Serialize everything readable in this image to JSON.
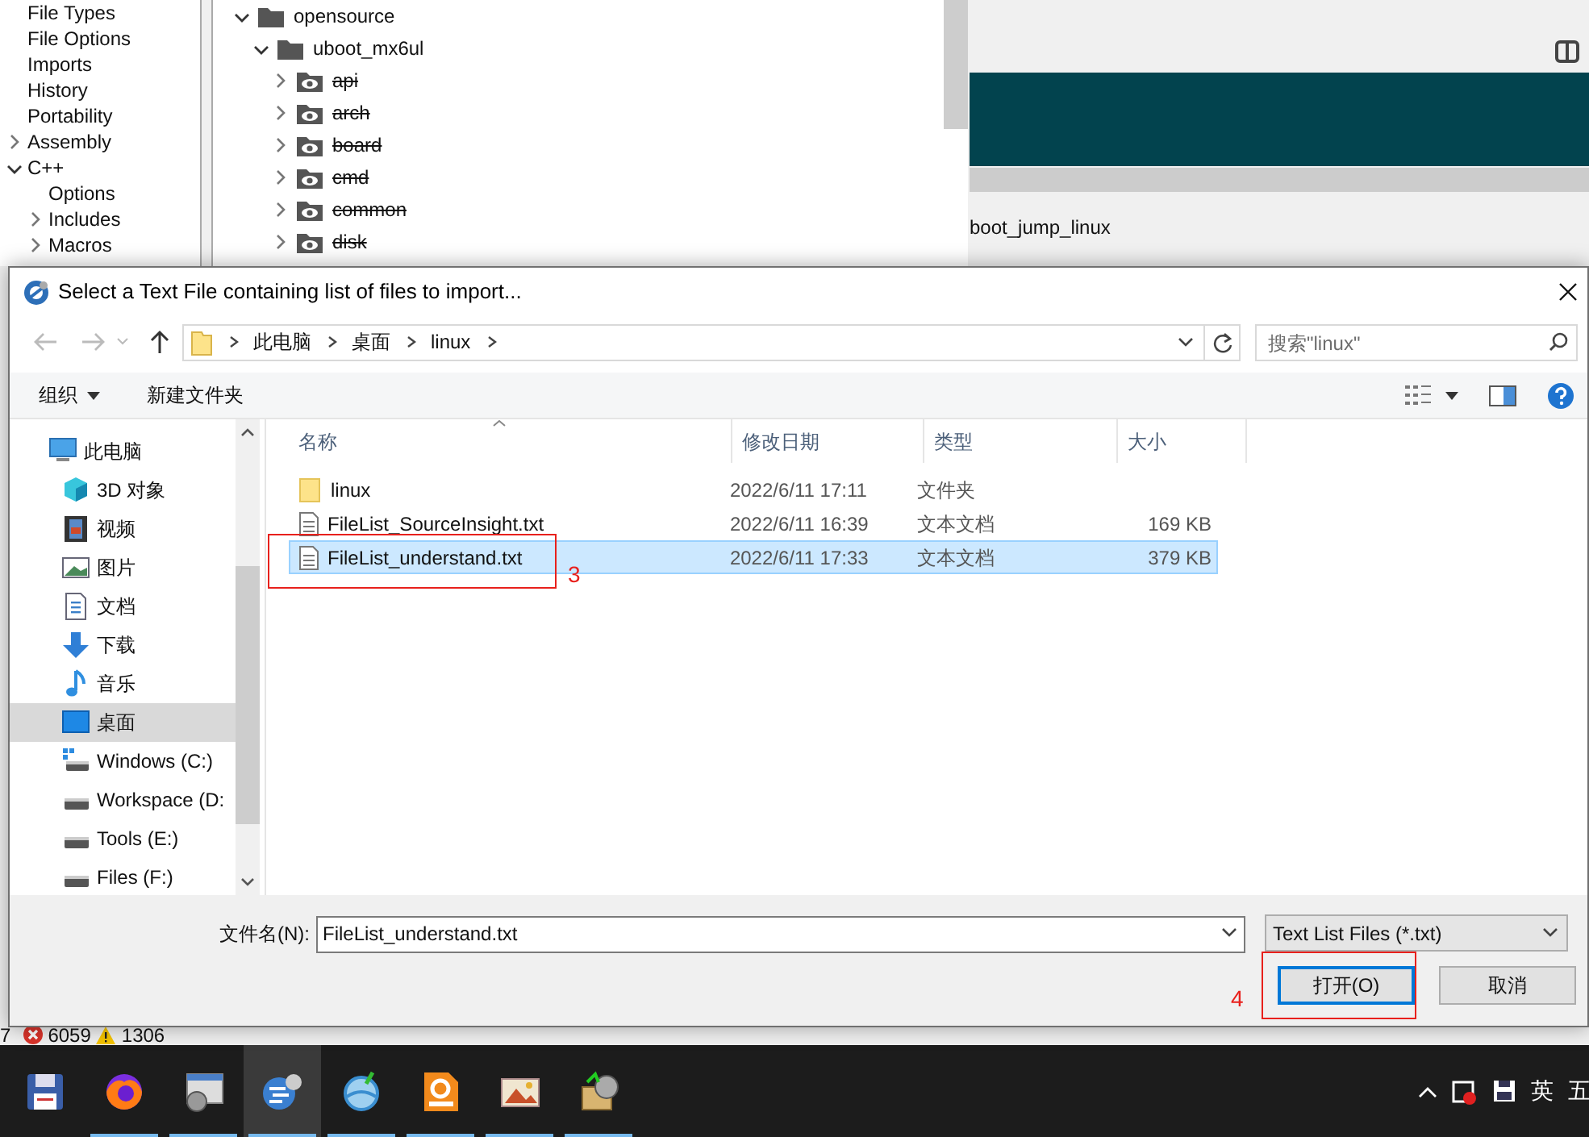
{
  "background_app": {
    "settings_tree": [
      {
        "label": "File Types",
        "kind": "leaf"
      },
      {
        "label": "File Options",
        "kind": "leaf"
      },
      {
        "label": "Imports",
        "kind": "leaf"
      },
      {
        "label": "History",
        "kind": "leaf"
      },
      {
        "label": "Portability",
        "kind": "leaf"
      },
      {
        "label": "Assembly",
        "kind": "group",
        "expanded": false
      },
      {
        "label": "C++",
        "kind": "group",
        "expanded": true,
        "children": [
          {
            "label": "Options",
            "kind": "leaf"
          },
          {
            "label": "Includes",
            "kind": "group",
            "expanded": false
          },
          {
            "label": "Macros",
            "kind": "group",
            "expanded": false
          }
        ]
      }
    ],
    "project_tree": [
      {
        "label": "opensource",
        "expanded": true,
        "excluded": false,
        "children": [
          {
            "label": "uboot_mx6ul",
            "expanded": true,
            "excluded": false,
            "children": [
              {
                "label": "api",
                "expanded": false,
                "excluded": true
              },
              {
                "label": "arch",
                "expanded": false,
                "excluded": true
              },
              {
                "label": "board",
                "expanded": false,
                "excluded": true
              },
              {
                "label": "cmd",
                "expanded": false,
                "excluded": true
              },
              {
                "label": "common",
                "expanded": false,
                "excluded": true
              },
              {
                "label": "disk",
                "expanded": false,
                "excluded": true
              }
            ]
          }
        ]
      }
    ],
    "editor_text": "boot_jump_linux",
    "status": {
      "column": "7",
      "errors": "6059",
      "warnings": "1306"
    }
  },
  "dialog": {
    "title": "Select a Text File containing list of files to import...",
    "address": {
      "path": [
        "此电脑",
        "桌面",
        "linux"
      ]
    },
    "search": {
      "placeholder": "搜索\"linux\""
    },
    "toolbar": {
      "organize": "组织",
      "new_folder": "新建文件夹"
    },
    "nav": [
      {
        "label": "此电脑",
        "kind": "pc",
        "selected": false,
        "children": [
          {
            "label": "3D 对象",
            "kind": "objects",
            "selected": false
          },
          {
            "label": "视频",
            "kind": "video",
            "selected": false
          },
          {
            "label": "图片",
            "kind": "pictures",
            "selected": false
          },
          {
            "label": "文档",
            "kind": "documents",
            "selected": false
          },
          {
            "label": "下载",
            "kind": "downloads",
            "selected": false
          },
          {
            "label": "音乐",
            "kind": "music",
            "selected": false
          },
          {
            "label": "桌面",
            "kind": "desktop",
            "selected": true
          },
          {
            "label": "Windows (C:)",
            "kind": "system_drive",
            "selected": false
          },
          {
            "label": "Workspace (D:",
            "kind": "drive",
            "selected": false
          },
          {
            "label": "Tools (E:)",
            "kind": "drive",
            "selected": false
          },
          {
            "label": "Files (F:)",
            "kind": "drive",
            "selected": false
          }
        ]
      }
    ],
    "columns": [
      "名称",
      "修改日期",
      "类型",
      "大小"
    ],
    "files": [
      {
        "name": "linux",
        "kind": "folder",
        "modified": "2022/6/11 17:11",
        "type": "文件夹",
        "selected": false
      },
      {
        "name": "FileList_SourceInsight.txt",
        "kind": "text",
        "modified": "2022/6/11 16:39",
        "type": "文本文档",
        "size": "169 KB",
        "selected": false
      },
      {
        "name": "FileList_understand.txt",
        "kind": "text",
        "modified": "2022/6/11 17:33",
        "type": "文本文档",
        "size": "379 KB",
        "selected": true
      }
    ],
    "filename_label": "文件名(N):",
    "filename": "FileList_understand.txt",
    "filter": "Text List Files (*.txt)",
    "buttons": [
      {
        "label": "打开(O)",
        "kind": "primary"
      },
      {
        "label": "取消",
        "kind": "secondary"
      }
    ]
  },
  "annotations": [
    {
      "text": "3"
    },
    {
      "text": "4"
    }
  ],
  "taskbar": {
    "apps": [
      {
        "running": false,
        "selected": false
      },
      {
        "running": true,
        "selected": false
      },
      {
        "running": true,
        "selected": false
      },
      {
        "running": true,
        "selected": true
      },
      {
        "running": true,
        "selected": false
      },
      {
        "running": true,
        "selected": false
      },
      {
        "running": true,
        "selected": false
      },
      {
        "running": true,
        "selected": false
      }
    ],
    "tray": {
      "language": "英",
      "ime": "五"
    }
  }
}
